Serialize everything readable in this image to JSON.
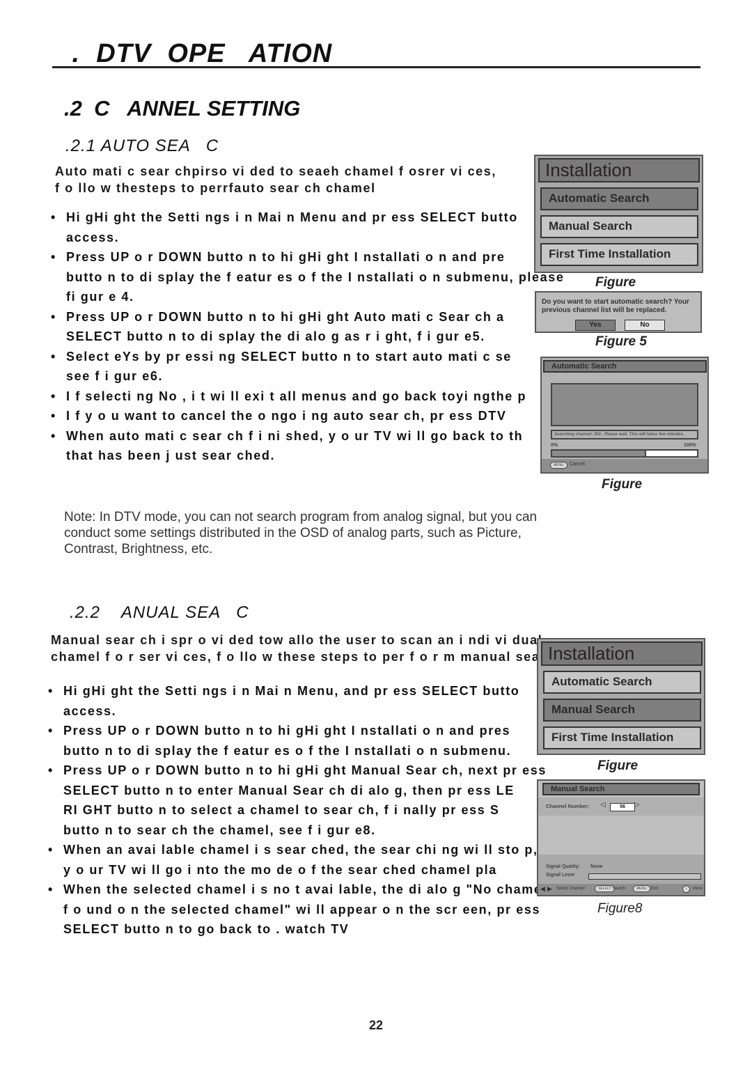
{
  "page": {
    "chapter_title": " .  DTV  OPE   ATION",
    "section_title": ".2  C   ANNEL SETTING",
    "page_number": "22"
  },
  "auto_search": {
    "heading": ".2.1 AUTO SEA   C",
    "intro": [
      "Auto mati c  sear chpirso vi ded  to   seaeh chamel  f osrer vi ces,",
      "f o llo w  thesteps  to   perrfauto   sear ch chamel"
    ],
    "bullets": [
      [
        "Hi gHi ght  the  Setti ngs  i n Mai n Menu  and  pr ess  SELECT  butto",
        "access."
      ],
      [
        "Press  UP  o r  DOWN  butto n to   hi gHi ght  I nstallati o n and  pre",
        "butto n to   di splay   the  f eatur es  o f   the  I nstallati o n submenu,  please  see",
        "fi gur e  4."
      ],
      [
        "Press  UP  o r  DOWN  butto n to   hi gHi ght  Auto mati c  Sear ch a",
        "SELECT  butto n to   di splay   the  di alo g  as  r i ght,  f i gur e5."
      ],
      [
        "Select eYs  by   pr essi ng  SELECT  butto n to   start  auto mati c  se",
        "see  f i gur e6."
      ],
      [
        "I f   selecti ng  No ,  i t  wi ll  exi t  all  menus  and  go   back toyi ngthe  p"
      ],
      [
        "I f   y o u  want  to   cancel  the  o ngo i ng  auto   sear ch,  pr ess  DTV"
      ],
      [
        "When auto mati c  sear ch f i ni shed,  y o ur   TV  wi ll  go   back to   th",
        "that  has  been j ust  sear ched."
      ]
    ]
  },
  "note": [
    "Note: In DTV mode, you can  not search program   from analog signal,   but you can",
    "conduct some settings    distributed in the   OSD of analog parts, such as  Picture,",
    "Contrast, Brightness, etc."
  ],
  "manual_search": {
    "heading": ".2.2    ANUAL SEA   C",
    "intro": [
      "Manual   sear ch i spr o vi ded  tow allo the user to   scan  an i ndi vi dual",
      "chamel  f o r ser vi ces,  f o llo w these   steps  to per f o r m  manual  sear ch"
    ],
    "bullets": [
      [
        "Hi gHi ght  the  Setti ngs  i n Mai n Menu,  and  pr ess  SELECT  butto",
        "access."
      ],
      [
        "Press  UP  o r  DOWN  butto n to   hi gHi ght  I nstallati o n and  pres",
        "butto n to   di splay   the  f eatur es  o f   the  I nstallati o n submenu."
      ],
      [
        "Press  UP  o r  DOWN  butto n to   hi gHi ght  Manual  Sear ch,  next  pr ess",
        "SELECT  butto n to   enter  Manual  Sear ch di alo g,  then pr ess  LE",
        "RI GHT  butto n to   select  a  chamel  to   sear ch,  f i nally  pr ess  S",
        "butto n to   sear ch the  chamel,  see  f i gur e8."
      ],
      [
        "When an avai lable  chamel  i s  sear ched,  the  sear chi ng  wi ll  sto p,",
        "y o ur   TV  wi ll  go   i nto   the  mo de  o f   the  sear ched  chamel  pla"
      ],
      [
        "When the  selected  chamel  i s  no t  avai lable,  the  di alo g \"No chamels",
        "f o und  o n the  selected  chamel\" wi ll  appear   o n the  scr een,  pr ess",
        "SELECT    butto n to   go   back to . watch TV"
      ]
    ]
  },
  "figures": {
    "fig4": {
      "title": "Installation",
      "items": [
        "Automatic Search",
        "Manual Search",
        "First Time Installation"
      ],
      "highlighted_index": 0,
      "caption": "Figure"
    },
    "fig5": {
      "message": "Do  you want to start automatic search? Your previous channel list will be replaced.",
      "yes_label": "Yes",
      "no_label": "No",
      "caption": "Figure 5"
    },
    "fig6": {
      "title": "Automatic Search",
      "status": "Searching channel: 350 , Please wait. This will takes few minutes.",
      "progress_min_label": "0%",
      "progress_max_label": "100%",
      "progress_percent": 65,
      "menu_key": "MENU",
      "cancel_label": "Cancel",
      "caption": "Figure"
    },
    "fig7": {
      "title": "Installation",
      "items": [
        "Automatic Search",
        "Manual Search",
        "First Time Installation"
      ],
      "highlighted_index": 1,
      "caption": "Figure"
    },
    "fig8": {
      "title": "Manual Search",
      "channel_label": "Channel Number:",
      "channel_value": "56",
      "signal_quality_label": "Signal Quality:",
      "signal_quality_value": "None",
      "signal_level_label": "Signal Lever",
      "signal_level_percent": 0,
      "footer": {
        "select_channel": "Select Channel",
        "select_key": "SELECT",
        "search": "Search",
        "menu_key": "MENU",
        "exit": "Exit",
        "info_key": "i",
        "more": "More"
      },
      "caption": "Figure8"
    }
  }
}
